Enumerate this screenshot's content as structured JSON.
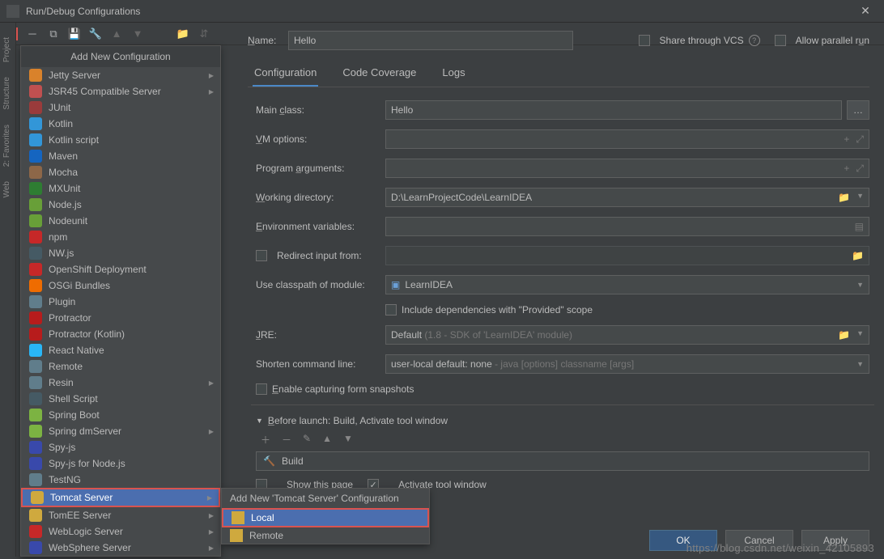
{
  "window": {
    "title": "Run/Debug Configurations"
  },
  "popup": {
    "title": "Add New Configuration",
    "items": [
      {
        "label": "Jetty Server",
        "color": "#d9822b",
        "sub": true
      },
      {
        "label": "JSR45 Compatible Server",
        "color": "#c05050",
        "sub": true
      },
      {
        "label": "JUnit",
        "color": "#9a3b3b"
      },
      {
        "label": "Kotlin",
        "color": "#3296d8"
      },
      {
        "label": "Kotlin script",
        "color": "#3296d8"
      },
      {
        "label": "Maven",
        "color": "#1565c0"
      },
      {
        "label": "Mocha",
        "color": "#8d6748"
      },
      {
        "label": "MXUnit",
        "color": "#2e7d32"
      },
      {
        "label": "Node.js",
        "color": "#689f38"
      },
      {
        "label": "Nodeunit",
        "color": "#689f38"
      },
      {
        "label": "npm",
        "color": "#c62828"
      },
      {
        "label": "NW.js",
        "color": "#455a64"
      },
      {
        "label": "OpenShift Deployment",
        "color": "#c62828"
      },
      {
        "label": "OSGi Bundles",
        "color": "#ef6c00"
      },
      {
        "label": "Plugin",
        "color": "#607d8b"
      },
      {
        "label": "Protractor",
        "color": "#b71c1c"
      },
      {
        "label": "Protractor (Kotlin)",
        "color": "#b71c1c"
      },
      {
        "label": "React Native",
        "color": "#29b6f6"
      },
      {
        "label": "Remote",
        "color": "#607d8b"
      },
      {
        "label": "Resin",
        "color": "#607d8b",
        "sub": true
      },
      {
        "label": "Shell Script",
        "color": "#455a64"
      },
      {
        "label": "Spring Boot",
        "color": "#7cb342"
      },
      {
        "label": "Spring dmServer",
        "color": "#7cb342",
        "sub": true
      },
      {
        "label": "Spy-js",
        "color": "#3949ab"
      },
      {
        "label": "Spy-js for Node.js",
        "color": "#3949ab"
      },
      {
        "label": "TestNG",
        "color": "#607d8b"
      },
      {
        "label": "Tomcat Server",
        "color": "#cfa93e",
        "sub": true,
        "hl": true,
        "boxed": true
      },
      {
        "label": "TomEE Server",
        "color": "#cfa93e",
        "sub": true
      },
      {
        "label": "WebLogic Server",
        "color": "#c62828",
        "sub": true
      },
      {
        "label": "WebSphere Server",
        "color": "#3949ab",
        "sub": true
      }
    ]
  },
  "submenu": {
    "title": "Add New 'Tomcat Server' Configuration",
    "items": [
      {
        "label": "Local",
        "hl": true,
        "boxed": true
      },
      {
        "label": "Remote"
      }
    ]
  },
  "form": {
    "name_label": "Name:",
    "name_value": "Hello",
    "share_label": "Share through VCS",
    "parallel_label": "Allow parallel run",
    "tabs": {
      "configuration": "Configuration",
      "coverage": "Code Coverage",
      "logs": "Logs"
    },
    "main_class_label": "Main class:",
    "main_class_value": "Hello",
    "vm_label": "VM options:",
    "args_label": "Program arguments:",
    "wd_label": "Working directory:",
    "wd_value": "D:\\LearnProjectCode\\LearnIDEA",
    "env_label": "Environment variables:",
    "redirect_label": "Redirect input from:",
    "classpath_label": "Use classpath of module:",
    "classpath_value": "LearnIDEA",
    "provided_label": "Include dependencies with \"Provided\" scope",
    "jre_label": "JRE:",
    "jre_value": "Default",
    "jre_hint": "(1.8 - SDK of 'LearnIDEA' module)",
    "shorten_label": "Shorten command line:",
    "shorten_value": "user-local default: none",
    "shorten_hint": "- java [options] classname [args]",
    "snapshots_label": "Enable capturing form snapshots",
    "before_label": "Before launch: Build, Activate tool window",
    "build_label": "Build",
    "show_page_label": "Show this page",
    "activate_label": "Activate tool window"
  },
  "buttons": {
    "ok": "OK",
    "cancel": "Cancel",
    "apply": "Apply"
  },
  "watermark": "https://blog.csdn.net/weixin_42105893",
  "sidetabs": [
    "Project",
    "Structure",
    "2: Favorites",
    "Web"
  ]
}
